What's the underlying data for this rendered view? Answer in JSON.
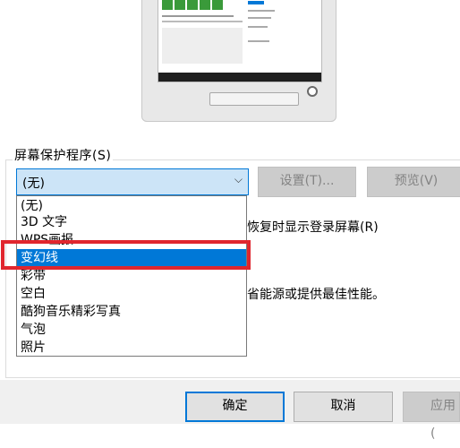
{
  "screensaver": {
    "group_label": "屏幕保护程序(S)",
    "selected": "(无)",
    "options": [
      "(无)",
      "3D 文字",
      "WPS画报",
      "变幻线",
      "彩带",
      "空白",
      "酷狗音乐精彩写真",
      "气泡",
      "照片"
    ],
    "highlighted_index": 3,
    "settings_label": "设置(T)...",
    "preview_label": "预览(V)"
  },
  "partial": {
    "resume_logon_text": "恢复时显示登录屏幕(R)",
    "power_text": "省能源或提供最佳性能。"
  },
  "footer": {
    "ok_label": "确定",
    "cancel_label": "取消",
    "apply_label": "应用("
  },
  "colors": {
    "selection": "#0078d7",
    "callout": "#e0262e",
    "combo_fill": "#cce4f7"
  }
}
